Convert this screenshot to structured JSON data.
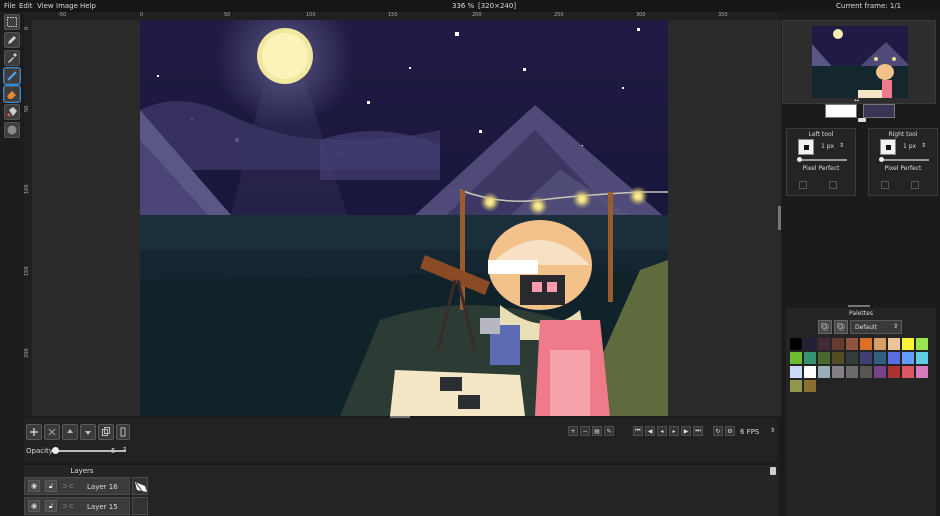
{
  "menu": [
    "File",
    "Edit",
    "View",
    "Image",
    "Help"
  ],
  "status": {
    "zoom": "336 %",
    "size": "[320×240]",
    "current_frame": "Current frame: 1/1"
  },
  "tools": [
    "rectangle-select-icon",
    "pencil-icon",
    "color-picker-icon",
    "line-icon",
    "eraser-icon",
    "bucket-icon",
    "shading-icon"
  ],
  "ruler": {
    "h_labels": [
      "-50",
      "0",
      "50",
      "100",
      "150",
      "200",
      "250",
      "300",
      "350"
    ],
    "v_labels": [
      "0",
      "50",
      "100",
      "150",
      "200"
    ]
  },
  "bottom": {
    "opacity_label": "Opacity:",
    "opacity_value": "5",
    "fps": "6 FPS"
  },
  "layers": {
    "header": "Layers",
    "rows": [
      {
        "name": "Layer 16"
      },
      {
        "name": "Layer 15"
      }
    ]
  },
  "left_tool": {
    "title": "Left tool",
    "size": "1 px",
    "pixel_perfect": "Pixel Perfect"
  },
  "right_tool": {
    "title": "Right tool",
    "size": "1 px",
    "pixel_perfect": "Pixel Perfect"
  },
  "palettes": {
    "title": "Palettes",
    "selected": "Default",
    "swatches": [
      "#000000",
      "#222034",
      "#45283c",
      "#663931",
      "#8f563b",
      "#df7126",
      "#d9a066",
      "#eec39a",
      "#fbf236",
      "#99e550",
      "#6abe30",
      "#37946e",
      "#4b692f",
      "#524b24",
      "#323c39",
      "#3f3f74",
      "#306082",
      "#5b6ee1",
      "#639bff",
      "#5fcde4",
      "#cbdbfc",
      "#ffffff",
      "#9badb7",
      "#847e87",
      "#696a6a",
      "#595652",
      "#76428a",
      "#ac3232",
      "#d95763",
      "#d77bba",
      "#8f974a",
      "#8a6f30"
    ]
  },
  "colors": {
    "primary": "#ffffff",
    "secondary": "#3b3555",
    "accent": "#2f8de0"
  }
}
